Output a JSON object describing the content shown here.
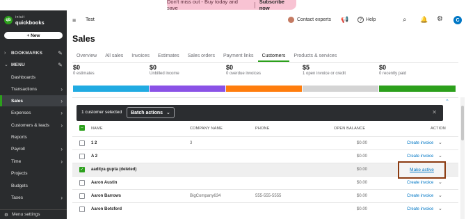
{
  "promo": {
    "text": "Don't miss out - Buy today and save",
    "cta": "Subscribe now"
  },
  "sidebar": {
    "logo_top": "intuit",
    "logo_bottom": "quickbooks",
    "new_label": "+ New",
    "bookmarks": "BOOKMARKS",
    "menu": "MENU",
    "items": [
      {
        "label": "Dashboards"
      },
      {
        "label": "Transactions"
      },
      {
        "label": "Sales"
      },
      {
        "label": "Expenses"
      },
      {
        "label": "Customers & leads"
      },
      {
        "label": "Reports"
      },
      {
        "label": "Payroll"
      },
      {
        "label": "Time"
      },
      {
        "label": "Projects"
      },
      {
        "label": "Budgets"
      },
      {
        "label": "Taxes"
      }
    ],
    "footer": "Menu settings"
  },
  "topbar": {
    "company": "Test",
    "contact": "Contact experts",
    "help": "Help",
    "user_initial": "C"
  },
  "page": {
    "title": "Sales",
    "tabs": [
      "Overview",
      "All sales",
      "Invoices",
      "Estimates",
      "Sales orders",
      "Payment links",
      "Customers",
      "Products & services"
    ],
    "active_tab": "Customers"
  },
  "money_bar": [
    {
      "amount": "$0",
      "label": "0 estimates",
      "color": "#21abe2"
    },
    {
      "amount": "$0",
      "label": "Unbilled income",
      "color": "#8a52e6"
    },
    {
      "amount": "$0",
      "label": "0 overdue invoices",
      "color": "#ff7d0d"
    },
    {
      "amount": "$5",
      "label": "1 open invoice or credit",
      "color": "#d4d4d4"
    },
    {
      "amount": "$0",
      "label": "0 recently paid",
      "color": "#2ca01c"
    }
  ],
  "batch": {
    "count_text": "1 customer selected",
    "button": "Batch actions",
    "close": "✕"
  },
  "table": {
    "headers": {
      "name": "NAME",
      "company": "COMPANY NAME",
      "phone": "PHONE",
      "balance": "OPEN BALANCE",
      "action": "ACTION"
    },
    "rows": [
      {
        "name": "1 2",
        "company": "3",
        "phone": "",
        "balance": "$0.00",
        "action": "Create invoice",
        "checked": false
      },
      {
        "name": "A 2",
        "company": "",
        "phone": "",
        "balance": "$0.00",
        "action": "Create invoice",
        "checked": false
      },
      {
        "name": "aaditya gupta (deleted)",
        "company": "",
        "phone": "",
        "balance": "$0.00",
        "action": "Make active",
        "checked": true
      },
      {
        "name": "Aaron Austin",
        "company": "",
        "phone": "",
        "balance": "$0.00",
        "action": "Create invoice",
        "checked": false
      },
      {
        "name": "Aaron Barrows",
        "company": "BigCompany634",
        "phone": "555-555-5555",
        "balance": "$0.00",
        "action": "Create invoice",
        "checked": false
      },
      {
        "name": "Aaron Botsford",
        "company": "",
        "phone": "",
        "balance": "$0.00",
        "action": "Create invoice",
        "checked": false
      }
    ]
  }
}
